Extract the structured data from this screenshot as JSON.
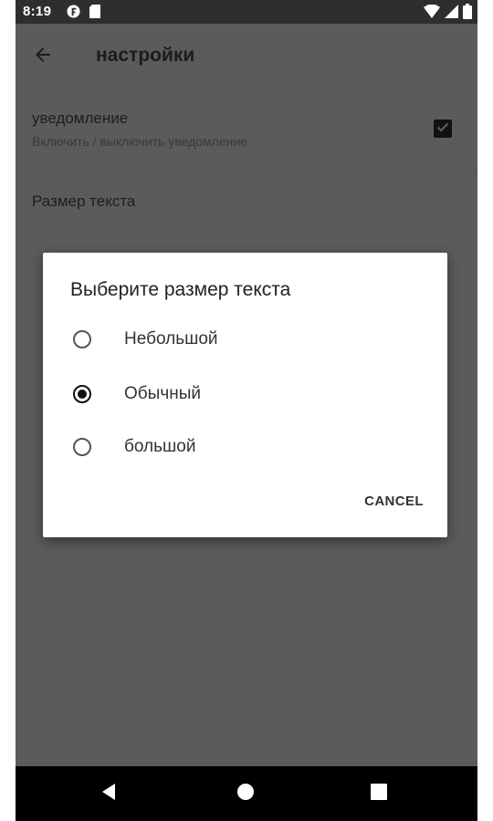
{
  "status_bar": {
    "time": "8:19",
    "left_icons": [
      "app-notification-icon",
      "sd-card-icon"
    ],
    "right_icons": [
      "wifi-icon",
      "signal-icon",
      "battery-icon"
    ]
  },
  "app_bar": {
    "back_icon": "arrow-left-icon",
    "title": "настройки"
  },
  "preferences": {
    "notification": {
      "title": "уведомление",
      "summary": "Включить / выключить уведомление",
      "checked": true
    },
    "text_size": {
      "title": "Размер текста"
    }
  },
  "dialog": {
    "title": "Выберите размер текста",
    "options": [
      {
        "label": "Небольшой",
        "selected": false
      },
      {
        "label": "Обычный",
        "selected": true
      },
      {
        "label": "большой",
        "selected": false
      }
    ],
    "cancel_label": "CANCEL"
  },
  "nav_bar": {
    "buttons": [
      "back-triangle-icon",
      "home-circle-icon",
      "recents-square-icon"
    ]
  },
  "colors": {
    "scrim_background": "#5b5b5b",
    "status_bar": "#2e2e2e",
    "nav_bar": "#000000",
    "dialog_background": "#ffffff",
    "accent": "#111111"
  }
}
